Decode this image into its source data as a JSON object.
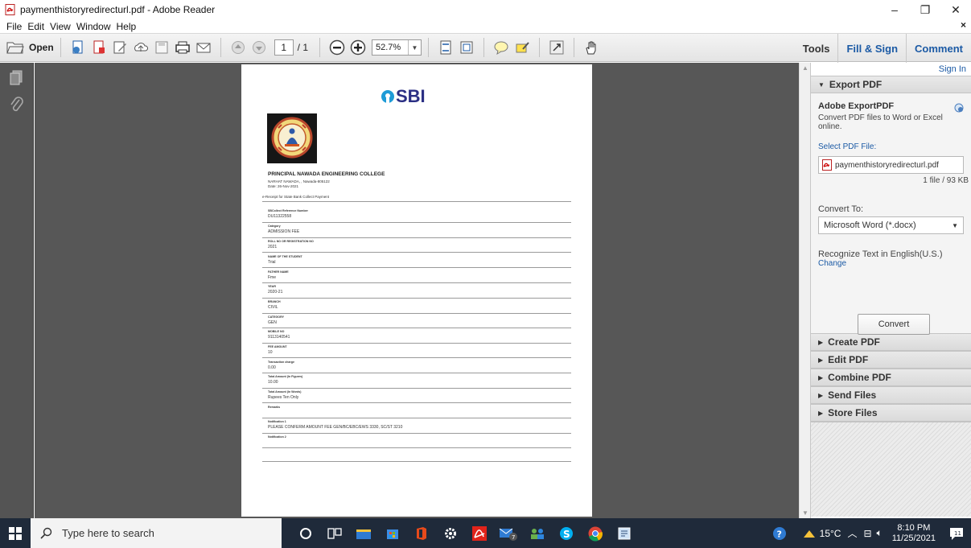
{
  "window": {
    "title": "paymenthistoryredirecturl.pdf - Adobe Reader",
    "minimize": "–",
    "restore": "❐",
    "close": "✕"
  },
  "menu": {
    "items": [
      "File",
      "Edit",
      "View",
      "Window",
      "Help"
    ],
    "close_doc": "×"
  },
  "toolbar": {
    "open_label": "Open",
    "current_page": "1",
    "page_total": "/ 1",
    "zoom": "52.7%",
    "tools_label": "Tools",
    "fill_sign_label": "Fill & Sign",
    "comment_label": "Comment"
  },
  "document": {
    "bank_logo_text": "SBI",
    "college_name": "PRINCIPAL NAWADA ENGINEERING COLLEGE",
    "college_address": "NARHAT NAWADA, , Nawada-805122",
    "receipt_date": "Date: 26-Nov-2021",
    "receipt_title": "e-Receipt for State Bank Collect Payment",
    "fields": [
      {
        "label": "SBCollect Reference Number",
        "value": "DU11322558"
      },
      {
        "label": "Category",
        "value": "ADMISSION FEE"
      },
      {
        "label": "ROLL NO OR REGISTRATION NO",
        "value": "2021"
      },
      {
        "label": "NAME OF THE STUDENT",
        "value": "Trial"
      },
      {
        "label": "FATHER NAME",
        "value": "Fme"
      },
      {
        "label": "YEAR",
        "value": "2020-21"
      },
      {
        "label": "BRANCH",
        "value": "CIVIL"
      },
      {
        "label": "CATEGORY",
        "value": "GEN"
      },
      {
        "label": "MOBILE NO",
        "value": "9113140541"
      },
      {
        "label": "FEE AMOUNT",
        "value": "10"
      },
      {
        "label": "Transaction charge",
        "value": "0.00"
      },
      {
        "label": "Total Amount (In Figures)",
        "value": "10.00"
      },
      {
        "label": "Total Amount (In Words)",
        "value": "Rupees Ten Only"
      },
      {
        "label": "Remarks",
        "value": ""
      },
      {
        "label": "Notification 1",
        "value": "PLEASE CONFERM AMOUNT FEE GEN/BC/EBC/EWS 3330, SC/ST 3210"
      },
      {
        "label": "Notification 2",
        "value": ""
      }
    ]
  },
  "right_pane": {
    "sign_in": "Sign In",
    "export_header": "Export PDF",
    "export_title": "Adobe ExportPDF",
    "export_desc": "Convert PDF files to Word or Excel online.",
    "select_label": "Select PDF File:",
    "file_name": "paymenthistoryredirecturl.pdf",
    "file_count": "1 file / 93 KB",
    "convert_to_label": "Convert To:",
    "convert_to_value": "Microsoft Word (*.docx)",
    "recognize_text": "Recognize Text in English(U.S.)",
    "change_link": "Change",
    "convert_button": "Convert",
    "sections": [
      "Create PDF",
      "Edit PDF",
      "Combine PDF",
      "Send Files",
      "Store Files"
    ]
  },
  "taskbar": {
    "search_placeholder": "Type here to search",
    "weather": "15°C",
    "time": "8:10 PM",
    "date": "11/25/2021",
    "mail_badge": "7",
    "notification_count": "11"
  },
  "colors": {
    "accent_blue": "#1b5aa5",
    "sbi_blue": "#1e9bd7",
    "taskbar": "#1f2a3a",
    "doc_background": "#575757"
  }
}
